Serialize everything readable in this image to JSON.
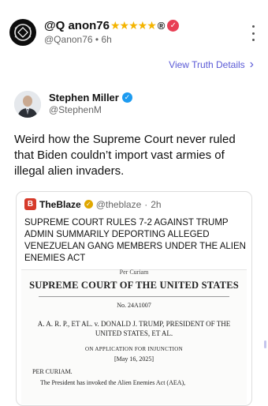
{
  "post": {
    "author_name": "@Q anon76",
    "stars": "★★★★★",
    "registered_mark": "®",
    "handle": "@Qanon76",
    "separator": "•",
    "time": "6h"
  },
  "view_details": {
    "label": "View Truth Details",
    "chevron": "›"
  },
  "quoted_user": {
    "name": "Stephen Miller",
    "handle": "@StephenM"
  },
  "post_text": "Weird how the Supreme Court never ruled that Biden couldn’t import vast armies of illegal alien invaders.",
  "card": {
    "source_logo": "B",
    "source_name": "TheBlaze",
    "source_handle": "@theblaze",
    "separator": "·",
    "time": "2h",
    "headline": "SUPREME COURT RULES 7-2 AGAINST TRUMP ADMIN SUMMARILY DEPORTING ALLEGED VENEZUELAN GANG MEMBERS UNDER THE ALIEN ENEMIES ACT",
    "document": {
      "curiam_top": "Per Curiam",
      "court": "SUPREME COURT OF THE UNITED STATES",
      "number": "No. 24A1007",
      "parties": "A. A. R. P., ET AL. v. DONALD J. TRUMP, PRESIDENT OF THE UNITED STATES, ET AL.",
      "application": "ON APPLICATION FOR INJUNCTION",
      "date": "[May 16, 2025]",
      "curiam": "PER CURIAM.",
      "body": "The President has invoked the Alien Enemies Act (AEA),"
    }
  },
  "colors": {
    "link": "#5a59d6",
    "star": "#f4b400",
    "badge_red": "#e83f55",
    "verified_blue": "#1d9bf0",
    "blaze_red": "#d63a2a"
  },
  "icons": [
    "more-vertical-icon",
    "verified-badge-icon",
    "chevron-right-icon",
    "gold-verified-icon",
    "blaze-logo-icon"
  ]
}
